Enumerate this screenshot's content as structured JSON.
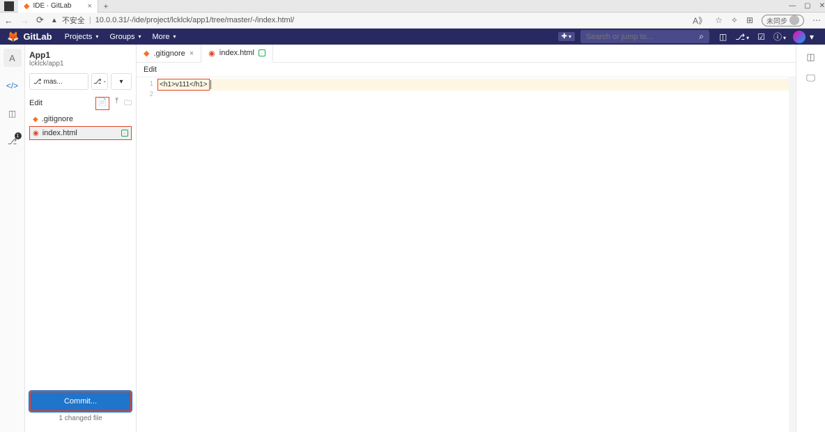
{
  "browser": {
    "tab_title": "IDE · GitLab",
    "security_text": "不安全",
    "url": "10.0.0.31/-/ide/project/lcklck/app1/tree/master/-/index.html/",
    "sync_label": "未同步"
  },
  "gitlab_nav": {
    "brand": "GitLab",
    "items": [
      "Projects",
      "Groups",
      "More"
    ],
    "search_placeholder": "Search or jump to..."
  },
  "project": {
    "letter": "A",
    "name": "App1",
    "path": "lcklck/app1",
    "branch_label": "mas...",
    "edit_label": "Edit",
    "changed_label": "1 changed file",
    "commit_label": "Commit...",
    "review_badge": "1"
  },
  "tree": [
    {
      "name": ".gitignore",
      "icon": "git",
      "selected": false,
      "modified": false
    },
    {
      "name": "index.html",
      "icon": "html",
      "selected": true,
      "modified": true
    }
  ],
  "tabs": [
    {
      "name": ".gitignore",
      "icon": "git",
      "active": false,
      "modified": false
    },
    {
      "name": "index.html",
      "icon": "html",
      "active": true,
      "modified": true
    }
  ],
  "editor": {
    "breadcrumb": "Edit",
    "lines": [
      {
        "n": 1,
        "text": "<h1>v111</h1>",
        "highlight": true
      },
      {
        "n": 2,
        "text": "",
        "highlight": false
      }
    ]
  }
}
